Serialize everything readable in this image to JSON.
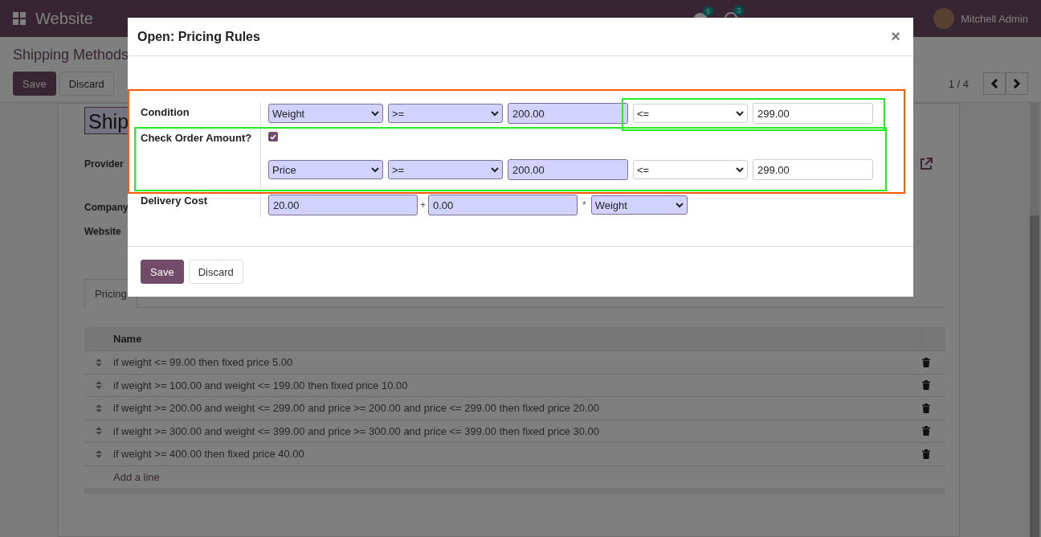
{
  "navbar": {
    "app_title": "Website",
    "messages_count": "5",
    "activities_count": "3",
    "user": "Mitchell Admin"
  },
  "control_panel": {
    "breadcrumb": "Shipping Methods",
    "buttons": [
      "Save",
      "Discard"
    ],
    "pager": "1 / 4"
  },
  "form": {
    "title": "Ship",
    "fields": [
      "Provider",
      "Company",
      "Website"
    ],
    "tabs": [
      {
        "label": "Pricing",
        "selected": true
      }
    ],
    "table": {
      "columns": [
        "Name"
      ],
      "rows": [
        "if weight <= 99.00 then fixed price 5.00",
        "if weight >= 100.00 and weight <= 199.00 then fixed price 10.00",
        "if weight >= 200.00 and weight <= 299.00 and price >= 200.00 and price <= 299.00 then fixed price 20.00",
        "if weight >= 300.00 and weight <= 399.00 and price >= 300.00 and price <= 399.00 then fixed price 30.00",
        "if weight >= 400.00 then fixed price 40.00"
      ],
      "add_line": "Add a line"
    }
  },
  "dialog": {
    "title": "Open: Pricing Rules",
    "close": "×",
    "condition": {
      "label": "Condition",
      "variable": "Weight",
      "operator": ">=",
      "min": "200.00",
      "operator2": "<=",
      "max": "299.00"
    },
    "check_order": {
      "label": "Check Order Amount?",
      "checked": true,
      "variable": "Price",
      "operator": ">=",
      "min": "200.00",
      "operator2": "<=",
      "max": "299.00"
    },
    "delivery_cost": {
      "label": "Delivery Cost",
      "fixed": "20.00",
      "plus": "+",
      "variable_price": "0.00",
      "times": "*",
      "factor": "Weight"
    },
    "buttons": [
      "Save",
      "Discard"
    ]
  },
  "highlights": [
    {
      "color": "#ff5a00"
    },
    {
      "color": "#22ee22"
    },
    {
      "color": "#22ee22"
    }
  ]
}
